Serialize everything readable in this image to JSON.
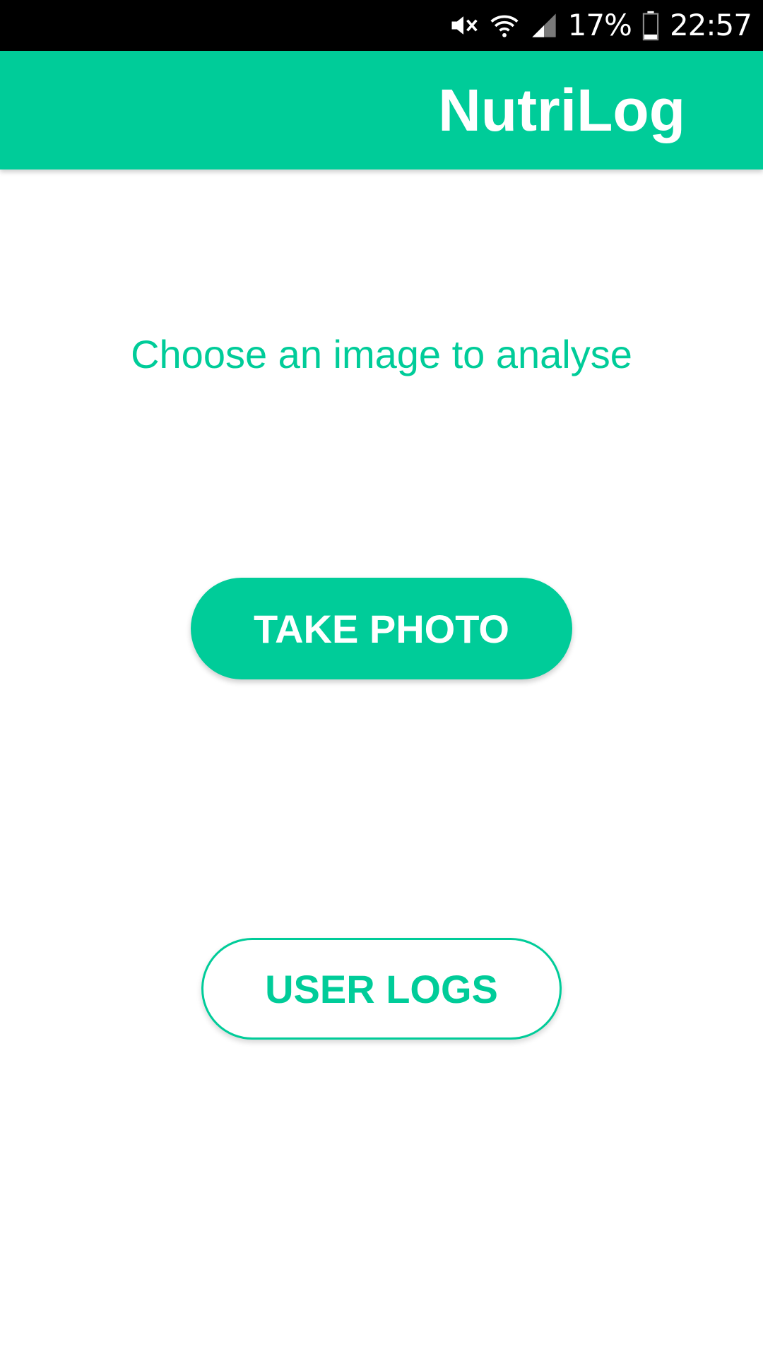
{
  "status_bar": {
    "battery_percent": "17%",
    "time": "22:57",
    "icons": [
      "mute-icon",
      "wifi-icon",
      "signal-icon",
      "battery-icon"
    ]
  },
  "app_bar": {
    "title": "NutriLog"
  },
  "main": {
    "prompt": "Choose an image to analyse",
    "take_photo_label": "TAKE PHOTO",
    "user_logs_label": "USER LOGS"
  },
  "colors": {
    "accent": "#00CC99",
    "status_bar_bg": "#000000",
    "background": "#FFFFFF",
    "on_accent": "#FFFFFF"
  }
}
